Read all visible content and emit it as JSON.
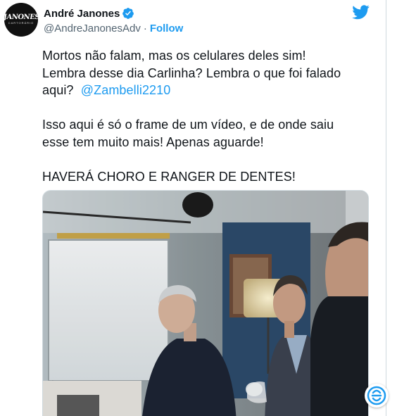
{
  "author": {
    "display_name": "André Janones",
    "handle": "@AndreJanonesAdv",
    "separator": "·",
    "follow_label": "Follow",
    "avatar_text": "JANONES",
    "avatar_subtext": "CARTORÁRIO",
    "verified": true
  },
  "tweet": {
    "line1": "Mortos não falam, mas os celulares deles sim!",
    "line2": "Lembra desse dia Carlinha? Lembra o que foi falado",
    "line3_prefix": "aqui?",
    "mention": "@Zambelli2210",
    "line4": "Isso aqui é só o frame de um vídeo, e de onde saiu",
    "line5": "esse tem muito mais! Apenas aguarde!",
    "line6": "HAVERÁ CHORO E RANGER DE DENTES!"
  },
  "icons": {
    "verified": "verified-badge-icon",
    "brand": "twitter-bird-icon",
    "overlay": "embed-widget-icon"
  },
  "colors": {
    "accent": "#1d9bf0",
    "text": "#0f1419",
    "muted": "#536471",
    "border": "#cfd9de"
  }
}
